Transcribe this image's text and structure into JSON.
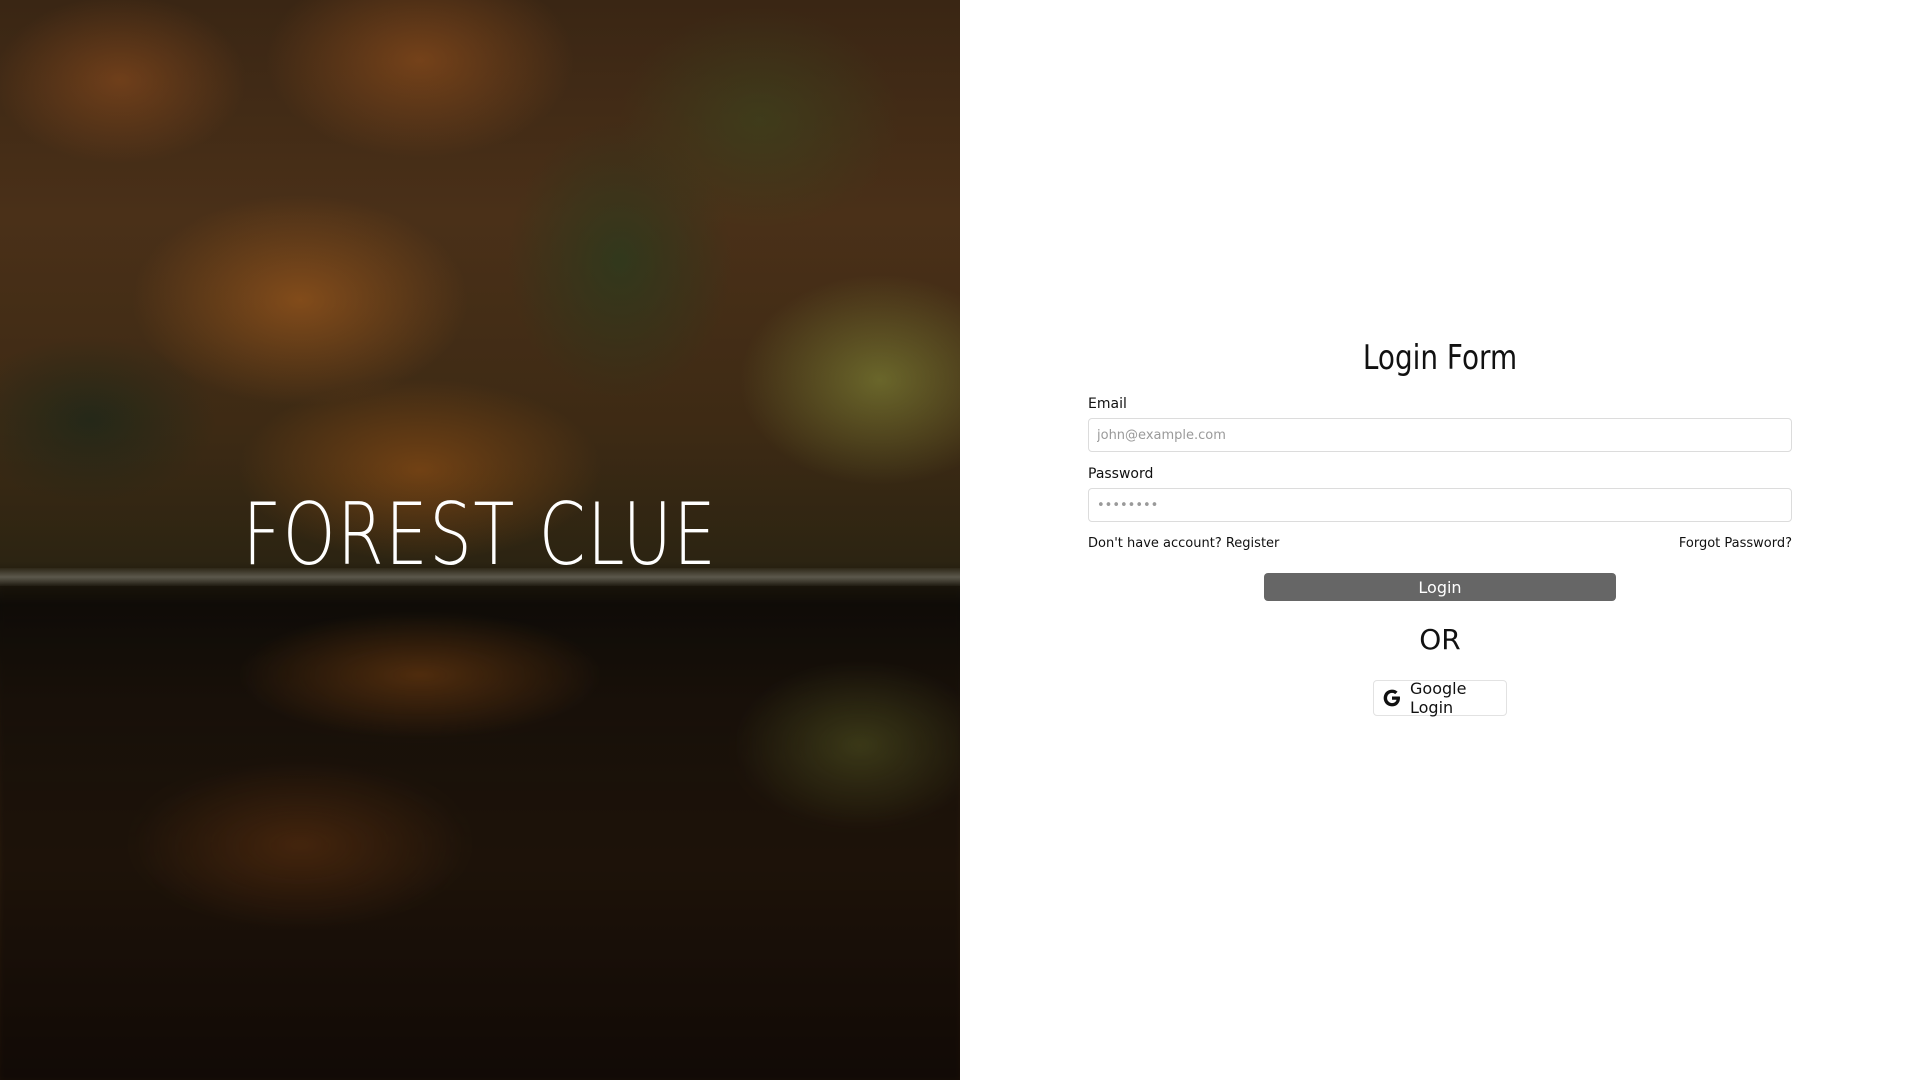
{
  "hero": {
    "title": "FOREST CLUE"
  },
  "login_form": {
    "title": "Login Form",
    "email": {
      "label": "Email",
      "placeholder": "john@example.com",
      "value": ""
    },
    "password": {
      "label": "Password",
      "placeholder": "••••••••",
      "value": ""
    },
    "register_link": "Don't have account? Register",
    "forgot_link": "Forgot Password?",
    "login_button": "Login",
    "divider": "OR",
    "google_button": "Google Login",
    "google_icon": "google-icon"
  },
  "colors": {
    "login_button_bg": "#666666",
    "panel_bg": "#ffffff",
    "hero_title": "#ffffff"
  }
}
